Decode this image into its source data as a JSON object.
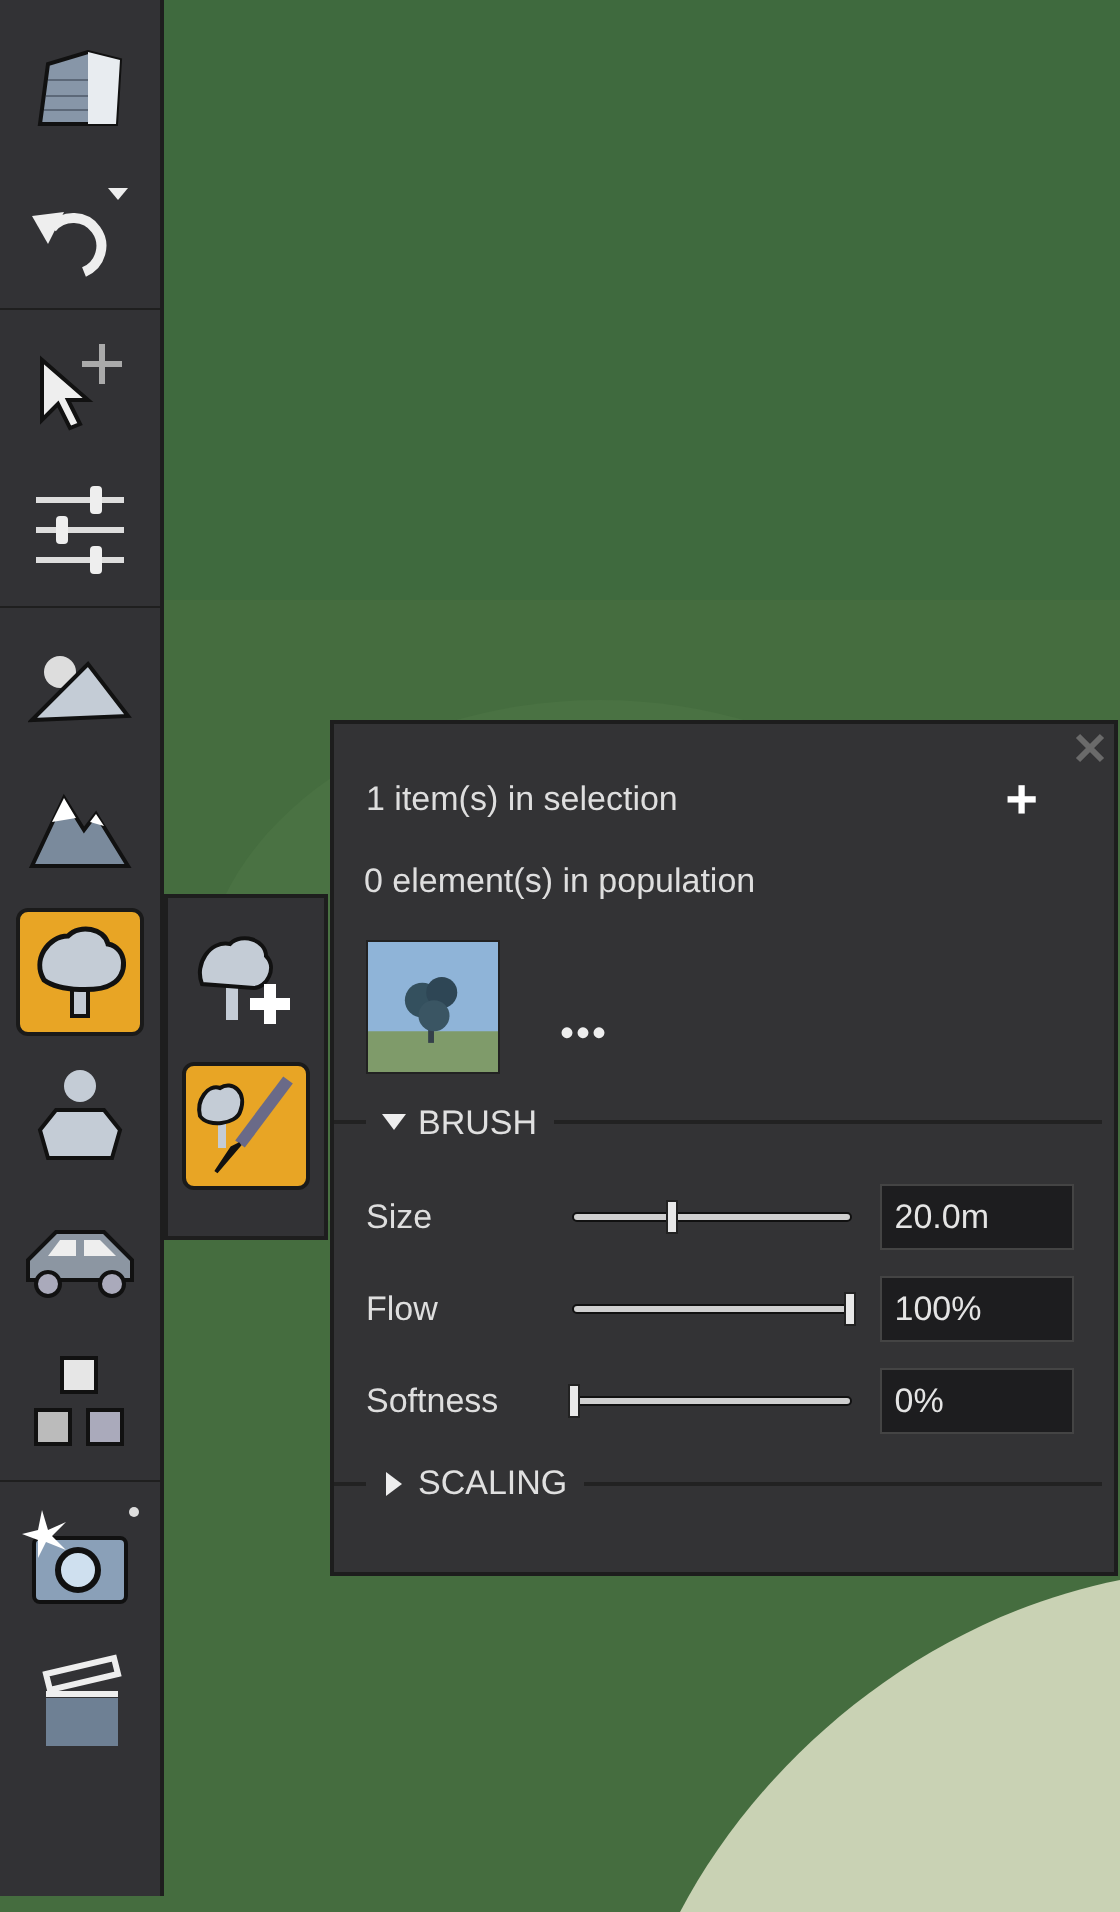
{
  "toolbar": {
    "groups": [
      {
        "tools": [
          {
            "selected": false
          },
          {
            "selected": false
          }
        ]
      },
      {
        "tools": [
          {
            "selected": false
          },
          {
            "selected": false
          }
        ]
      },
      {
        "tools": [
          {
            "selected": false
          },
          {
            "selected": false
          },
          {
            "selected": true
          },
          {
            "selected": false
          },
          {
            "selected": false
          },
          {
            "selected": false
          }
        ]
      },
      {
        "tools": [
          {
            "selected": false
          },
          {
            "selected": false
          }
        ]
      }
    ]
  },
  "subtoolbar": {
    "tools": [
      {
        "selected": false
      },
      {
        "selected": true
      }
    ]
  },
  "panel": {
    "selection_count": "1 item(s) in selection",
    "add_label": "+",
    "population_count": "0 element(s) in population",
    "more_label": "•••",
    "sections": [
      {
        "title": "BRUSH",
        "expanded": true,
        "sliders": [
          {
            "label": "Size",
            "level": 0.35,
            "value": "20.0m"
          },
          {
            "label": "Flow",
            "level": 1.0,
            "value": "100%"
          },
          {
            "label": "Softness",
            "level": 0.0,
            "value": "0%"
          }
        ]
      },
      {
        "title": "SCALING",
        "expanded": false
      }
    ]
  }
}
